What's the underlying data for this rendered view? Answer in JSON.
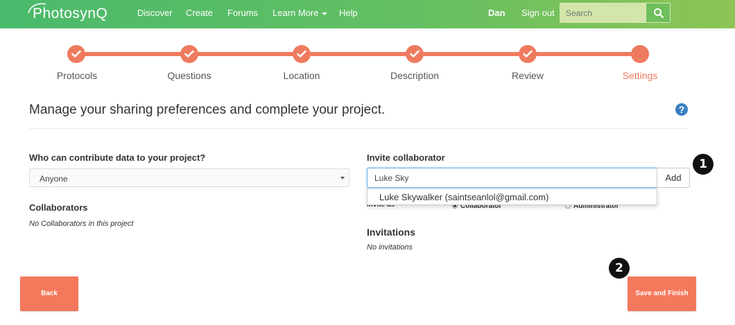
{
  "navbar": {
    "logo_text": "PhotosynQ",
    "links": [
      "Discover",
      "Create",
      "Forums",
      "Learn More",
      "Help"
    ],
    "user": "Dan",
    "signout": "Sign out",
    "search_placeholder": "Search"
  },
  "steps": [
    {
      "label": "Protocols",
      "done": true
    },
    {
      "label": "Questions",
      "done": true
    },
    {
      "label": "Location",
      "done": true
    },
    {
      "label": "Description",
      "done": true
    },
    {
      "label": "Review",
      "done": true
    },
    {
      "label": "Settings",
      "done": false,
      "active": true
    }
  ],
  "page": {
    "title": "Manage your sharing preferences and complete your project.",
    "help": "?"
  },
  "contribute": {
    "label": "Who can contribute data to your project?",
    "selected": "Anyone"
  },
  "collaborators": {
    "heading": "Collaborators",
    "empty": "No Collaborators in this project"
  },
  "invite": {
    "label": "Invite collaborator",
    "value": "Luke Sky",
    "add": "Add",
    "invite_as": "Invite as",
    "role_collaborator": "Collaborator",
    "role_administrator": "Administrator",
    "suggestion": "Luke Skywalker (saintseanlol@gmail.com)"
  },
  "invitations": {
    "heading": "Invitations",
    "empty": "No invitations"
  },
  "buttons": {
    "back": "Back",
    "save": "Save and Finish"
  },
  "badges": [
    "1",
    "2"
  ],
  "colors": {
    "accent": "#ef7b5f",
    "navbar_start": "#4aba6c",
    "navbar_end": "#8dc556",
    "help": "#3a7fc0"
  }
}
